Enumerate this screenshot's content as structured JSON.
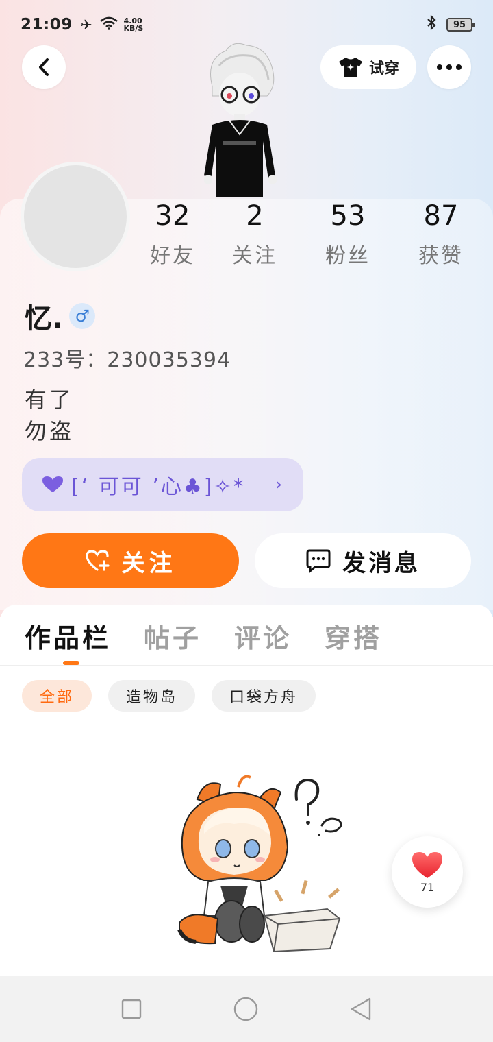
{
  "status_bar": {
    "time": "21:09",
    "net_speed_value": "4.00",
    "net_speed_unit": "KB/S",
    "battery": "95"
  },
  "header": {
    "try_on_label": "试穿"
  },
  "stats": [
    {
      "value": "32",
      "label": "好友"
    },
    {
      "value": "2",
      "label": "关注"
    },
    {
      "value": "53",
      "label": "粉丝"
    },
    {
      "value": "87",
      "label": "获赞"
    }
  ],
  "profile": {
    "username": "忆.",
    "gender_symbol": "♂",
    "uid": "233号：230035394",
    "bio_line1": "有了",
    "bio_line2": "勿盗",
    "signature": "[‘ 可可 ’心♣]✧*"
  },
  "actions": {
    "follow_label": "关注",
    "message_label": "发消息"
  },
  "tabs": [
    {
      "label": "作品栏",
      "active": true
    },
    {
      "label": "帖子",
      "active": false
    },
    {
      "label": "评论",
      "active": false
    },
    {
      "label": "穿搭",
      "active": false
    }
  ],
  "chips": [
    {
      "label": "全部",
      "active": true
    },
    {
      "label": "造物岛",
      "active": false
    },
    {
      "label": "口袋方舟",
      "active": false
    }
  ],
  "like_count": "71",
  "colors": {
    "accent": "#ff7715",
    "signature_bg": "#e1ddf6",
    "signature_text": "#6b55d6"
  }
}
